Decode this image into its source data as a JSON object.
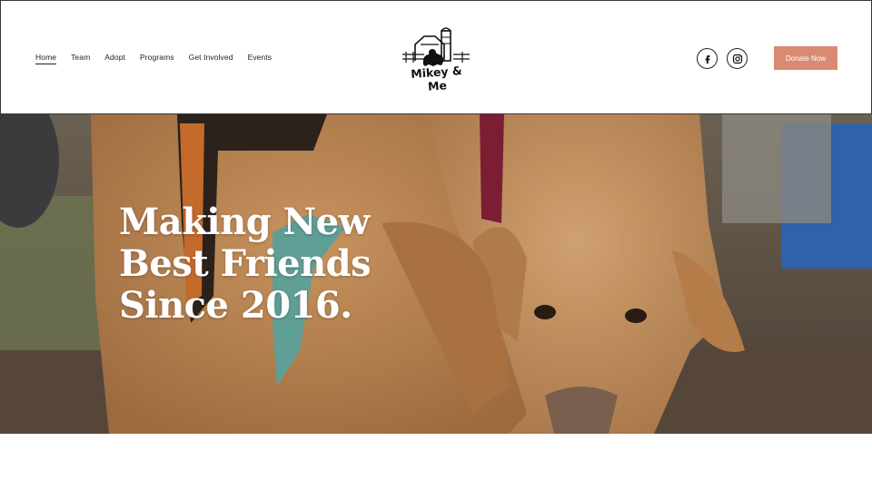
{
  "site": {
    "logo_text": "Mikey & Me"
  },
  "nav": {
    "items": [
      {
        "label": "Home",
        "active": true
      },
      {
        "label": "Team",
        "active": false
      },
      {
        "label": "Adopt",
        "active": false
      },
      {
        "label": "Programs",
        "active": false
      },
      {
        "label": "Get Involved",
        "active": false
      },
      {
        "label": "Events",
        "active": false
      }
    ]
  },
  "social": {
    "facebook_icon": "facebook-icon",
    "instagram_icon": "instagram-icon"
  },
  "cta": {
    "donate_label": "Donate Now",
    "color": "#d98a72"
  },
  "hero": {
    "headline_lines": [
      "Making New",
      "Best Friends",
      "Since 2016."
    ],
    "image": "two-tan-dogs-sniffing-ground"
  },
  "colors": {
    "border": "#3a3a3a",
    "text": "#222222",
    "button": "#d98a72"
  }
}
